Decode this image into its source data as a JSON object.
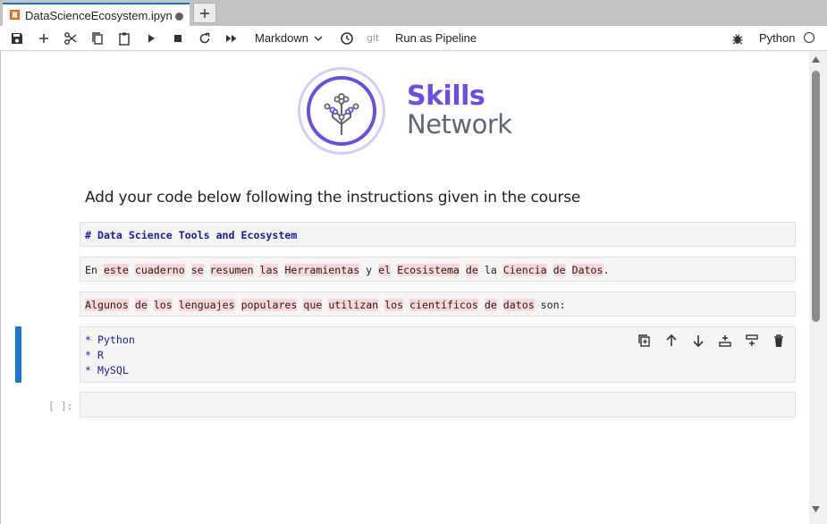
{
  "tab": {
    "title": "DataScienceEcosystem.ipyn"
  },
  "toolbar": {
    "cell_type": "Markdown",
    "git_label": "git",
    "pipeline_label": "Run as Pipeline",
    "kernel_name": "Python"
  },
  "logo": {
    "line1": "Skills",
    "line2": "Network"
  },
  "notebook": {
    "heading": "Add your code below following the instructions given in the course",
    "cell1": "# Data Science Tools and Ecosystem",
    "cell2": [
      {
        "t": "En ",
        "h": false
      },
      {
        "t": "este",
        "h": true
      },
      {
        "t": " ",
        "h": false
      },
      {
        "t": "cuaderno",
        "h": true
      },
      {
        "t": " ",
        "h": false
      },
      {
        "t": "se",
        "h": true
      },
      {
        "t": " ",
        "h": false
      },
      {
        "t": "resumen",
        "h": true
      },
      {
        "t": " ",
        "h": false
      },
      {
        "t": "las",
        "h": true
      },
      {
        "t": " ",
        "h": false
      },
      {
        "t": "Herramientas",
        "h": true
      },
      {
        "t": " y ",
        "h": false
      },
      {
        "t": "el",
        "h": true
      },
      {
        "t": " ",
        "h": false
      },
      {
        "t": "Ecosistema",
        "h": true
      },
      {
        "t": " ",
        "h": false
      },
      {
        "t": "de",
        "h": true
      },
      {
        "t": " la ",
        "h": false
      },
      {
        "t": "Ciencia",
        "h": true
      },
      {
        "t": " ",
        "h": false
      },
      {
        "t": "de",
        "h": true
      },
      {
        "t": " ",
        "h": false
      },
      {
        "t": "Datos",
        "h": true
      },
      {
        "t": ".",
        "h": false
      }
    ],
    "cell3": [
      {
        "t": "Algunos",
        "h": true
      },
      {
        "t": " ",
        "h": false
      },
      {
        "t": "de",
        "h": true
      },
      {
        "t": " ",
        "h": false
      },
      {
        "t": "los",
        "h": true
      },
      {
        "t": " ",
        "h": false
      },
      {
        "t": "lenguajes",
        "h": true
      },
      {
        "t": " ",
        "h": false
      },
      {
        "t": "populares",
        "h": true
      },
      {
        "t": " ",
        "h": false
      },
      {
        "t": "que",
        "h": true
      },
      {
        "t": " ",
        "h": false
      },
      {
        "t": "utilizan",
        "h": true
      },
      {
        "t": " ",
        "h": false
      },
      {
        "t": "los",
        "h": true
      },
      {
        "t": " ",
        "h": false
      },
      {
        "t": "científicos",
        "h": true
      },
      {
        "t": " ",
        "h": false
      },
      {
        "t": "de",
        "h": true
      },
      {
        "t": " ",
        "h": false
      },
      {
        "t": "datos",
        "h": true
      },
      {
        "t": " son:",
        "h": false
      }
    ],
    "cell4_lines": [
      "* Python",
      "* R",
      "* MySQL"
    ],
    "empty_prompt": "[ ]:"
  },
  "colors": {
    "accent": "#1976d2",
    "brand_purple": "#6b4ee6",
    "highlight": "#fbd7d7"
  }
}
